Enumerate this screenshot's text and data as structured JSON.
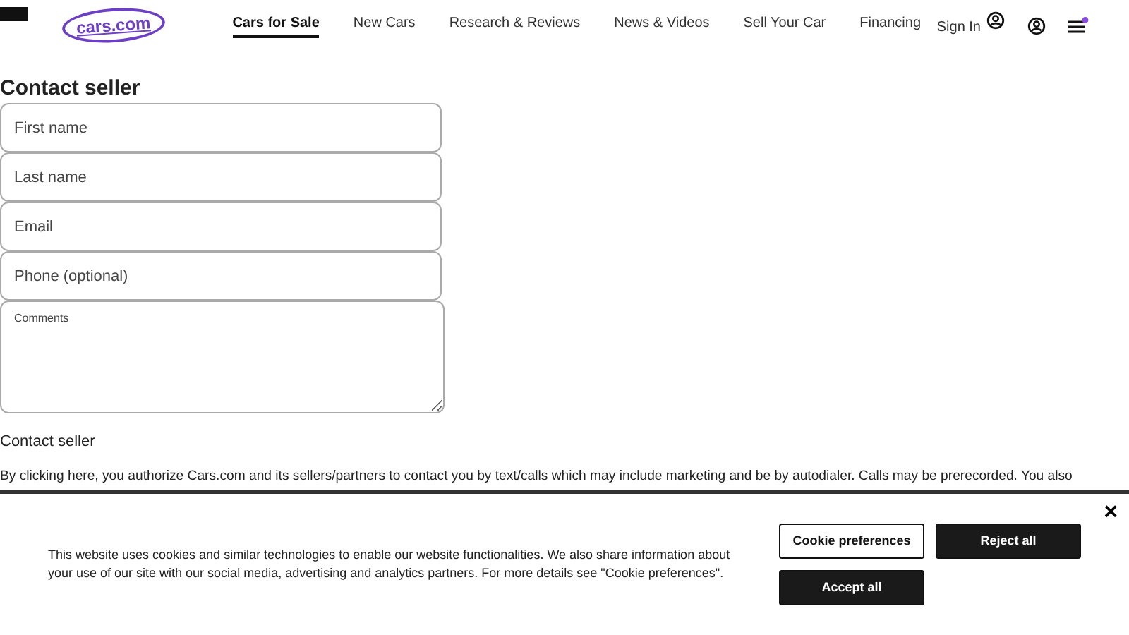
{
  "header": {
    "logo": "cars.com",
    "nav": [
      {
        "label": "Cars for Sale",
        "selected": true
      },
      {
        "label": "New Cars",
        "selected": false
      },
      {
        "label": "Research & Reviews",
        "selected": false
      },
      {
        "label": "News & Videos",
        "selected": false
      },
      {
        "label": "Sell Your Car",
        "selected": false
      },
      {
        "label": "Financing",
        "selected": false
      }
    ],
    "sign_in": "Sign In",
    "menu_notification": true
  },
  "form": {
    "title": "Contact seller",
    "fields": [
      {
        "placeholder": "First name",
        "kind": "input"
      },
      {
        "placeholder": "Last name",
        "kind": "input"
      },
      {
        "placeholder": "Email",
        "kind": "input"
      },
      {
        "placeholder": "Phone (optional)",
        "kind": "input"
      },
      {
        "placeholder": "Comments",
        "kind": "textarea"
      }
    ],
    "submit_label": "Contact seller",
    "disclaimer": "By clicking here, you authorize Cars.com and its sellers/partners to contact you by text/calls which may include marketing and be by autodialer. Calls may be prerecorded. You also"
  },
  "cookie_banner": {
    "text": "This website uses cookies and similar technologies to enable our website functionalities. We also share information about your use of our site with our social media, advertising and analytics partners. For more details see \"Cookie preferences\".",
    "buttons": [
      {
        "label": "Cookie preferences",
        "kind": "outline"
      },
      {
        "label": "Reject all",
        "kind": "solid"
      },
      {
        "label": "Accept all",
        "kind": "solid"
      }
    ],
    "close": "×"
  }
}
